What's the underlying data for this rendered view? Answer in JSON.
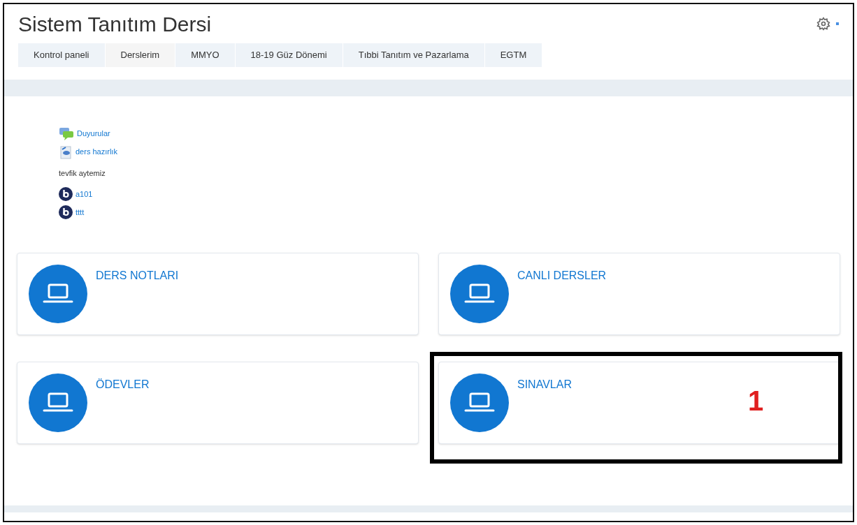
{
  "page_title": "Sistem Tanıtım Dersi",
  "breadcrumbs": [
    "Kontrol paneli",
    "Derslerim",
    "MMYO",
    "18-19 Güz Dönemi",
    "Tıbbi Tanıtım ve Pazarlama",
    "EGTM"
  ],
  "activities": [
    {
      "kind": "forum",
      "text": "Duyurular"
    },
    {
      "kind": "resource",
      "text": "ders hazırlık"
    },
    {
      "kind": "label",
      "text": "tevfik aytemiz"
    },
    {
      "kind": "bbb",
      "text": "a101"
    },
    {
      "kind": "bbb",
      "text": "tttt"
    }
  ],
  "tiles": [
    {
      "title": "DERS NOTLARI",
      "highlighted": false
    },
    {
      "title": "CANLI DERSLER",
      "highlighted": false
    },
    {
      "title": "ÖDEVLER",
      "highlighted": false
    },
    {
      "title": "SINAVLAR",
      "highlighted": true,
      "callout": "1"
    }
  ]
}
